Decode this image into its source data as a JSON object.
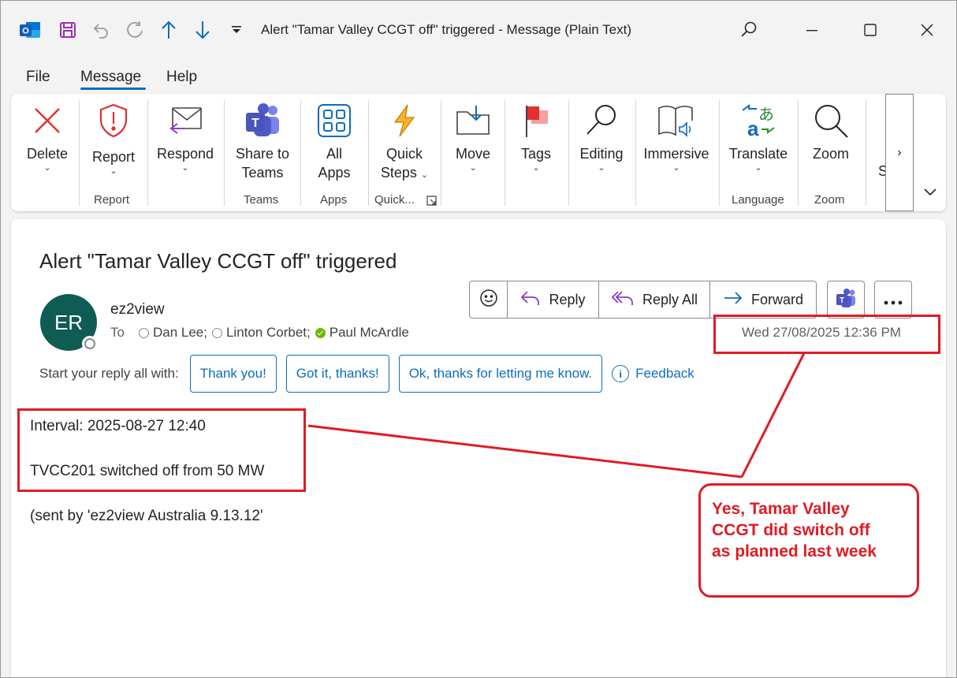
{
  "window": {
    "title": "Alert \"Tamar Valley CCGT off\" triggered  -  Message (Plain Text)"
  },
  "menu": {
    "tabs": [
      "File",
      "Message",
      "Help"
    ],
    "active": "Message"
  },
  "ribbon": {
    "buttons": {
      "delete": "Delete",
      "report": "Report",
      "respond": "Respond",
      "share_teams_1": "Share to",
      "share_teams_2": "Teams",
      "all_apps_1": "All",
      "all_apps_2": "Apps",
      "quick_steps_1": "Quick",
      "quick_steps_2": "Steps",
      "move": "Move",
      "tags": "Tags",
      "editing": "Editing",
      "immersive": "Immersive",
      "translate": "Translate",
      "zoom": "Zoom",
      "overflow_letter": "S"
    },
    "groups": {
      "report": "Report",
      "teams": "Teams",
      "apps": "Apps",
      "quick": "Quick...",
      "language": "Language",
      "zoom": "Zoom"
    },
    "more_glyph": "›",
    "collapse_glyph": "⌄"
  },
  "message": {
    "subject": "Alert \"Tamar Valley CCGT off\" triggered",
    "avatar_initials": "ER",
    "sender": "ez2view",
    "to_label": "To",
    "recipients": [
      "Dan Lee;",
      "Linton Corbet;",
      "Paul McArdle"
    ],
    "date": "Wed 27/08/2025 12:36 PM",
    "actions": {
      "reply": "Reply",
      "reply_all": "Reply All",
      "forward": "Forward"
    },
    "quick_reply": {
      "prompt": "Start your reply all with:",
      "options": [
        "Thank you!",
        "Got it, thanks!",
        "Ok, thanks for letting me know."
      ],
      "feedback": "Feedback"
    },
    "body": {
      "line1": "Interval: 2025-08-27 12:40",
      "line2": "TVCC201 switched off from 50 MW",
      "line3": "(sent by 'ez2view Australia 9.13.12'"
    }
  },
  "annotation": {
    "callout_line1": "Yes, Tamar Valley",
    "callout_line2": "CCGT did switch off",
    "callout_line3": "as planned last week",
    "color": "#e01b24"
  }
}
